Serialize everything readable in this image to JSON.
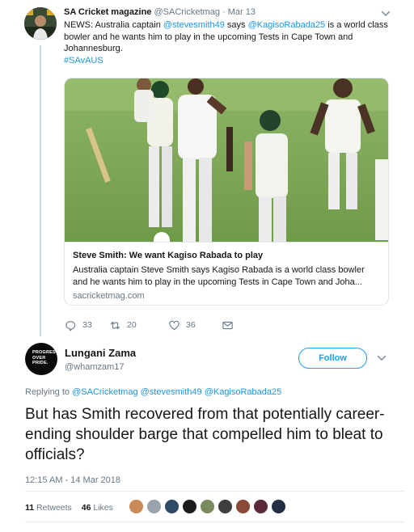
{
  "parent_tweet": {
    "display_name": "SA Cricket magazine",
    "handle": "@SACricketmag",
    "separator": "·",
    "date": "Mar 13",
    "text_parts": [
      "NEWS: Australia captain ",
      "@stevesmith49",
      " says ",
      "@KagisoRabada25",
      " is a world class bowler and he wants him to play in the upcoming Tests in Cape Town and Johannesburg."
    ],
    "hashtag": "#SAvAUS",
    "card": {
      "title": "Steve Smith: We want Kagiso Rabada to play",
      "description_line1": "Australia captain Steve Smith says Kagiso Rabada is a world class bowler",
      "description_line2": "and he wants him to play in the upcoming Tests in Cape Town and Joha...",
      "domain": "sacricketmag.com"
    },
    "actions": {
      "reply_count": "33",
      "retweet_count": "20",
      "like_count": "36"
    }
  },
  "main_tweet": {
    "avatar_text": [
      "PROGRESS",
      "OVER",
      "PRIDE."
    ],
    "display_name": "Lungani Zama",
    "handle": "@whamzam17",
    "follow_label": "Follow",
    "replying_to_label": "Replying to",
    "replying_to": [
      "@SACricketmag",
      "@stevesmith49",
      "@KagisoRabada25"
    ],
    "text": "But has Smith recovered from that potentially career-ending shoulder barge that compelled him to bleat to officials?",
    "timestamp": "12:15 AM - 14 Mar 2018",
    "retweets_count": "11",
    "retweets_label": "Retweets",
    "likes_count": "46",
    "likes_label": "Likes"
  },
  "colors": {
    "link": "#1b95e0",
    "follow": "#1da1f2",
    "muted": "#657786",
    "text": "#14171a",
    "border": "#e1e8ed"
  },
  "icons": {
    "reply": "reply-icon",
    "retweet": "retweet-icon",
    "like": "heart-icon",
    "dm": "envelope-icon",
    "caret": "chevron-down-icon"
  }
}
